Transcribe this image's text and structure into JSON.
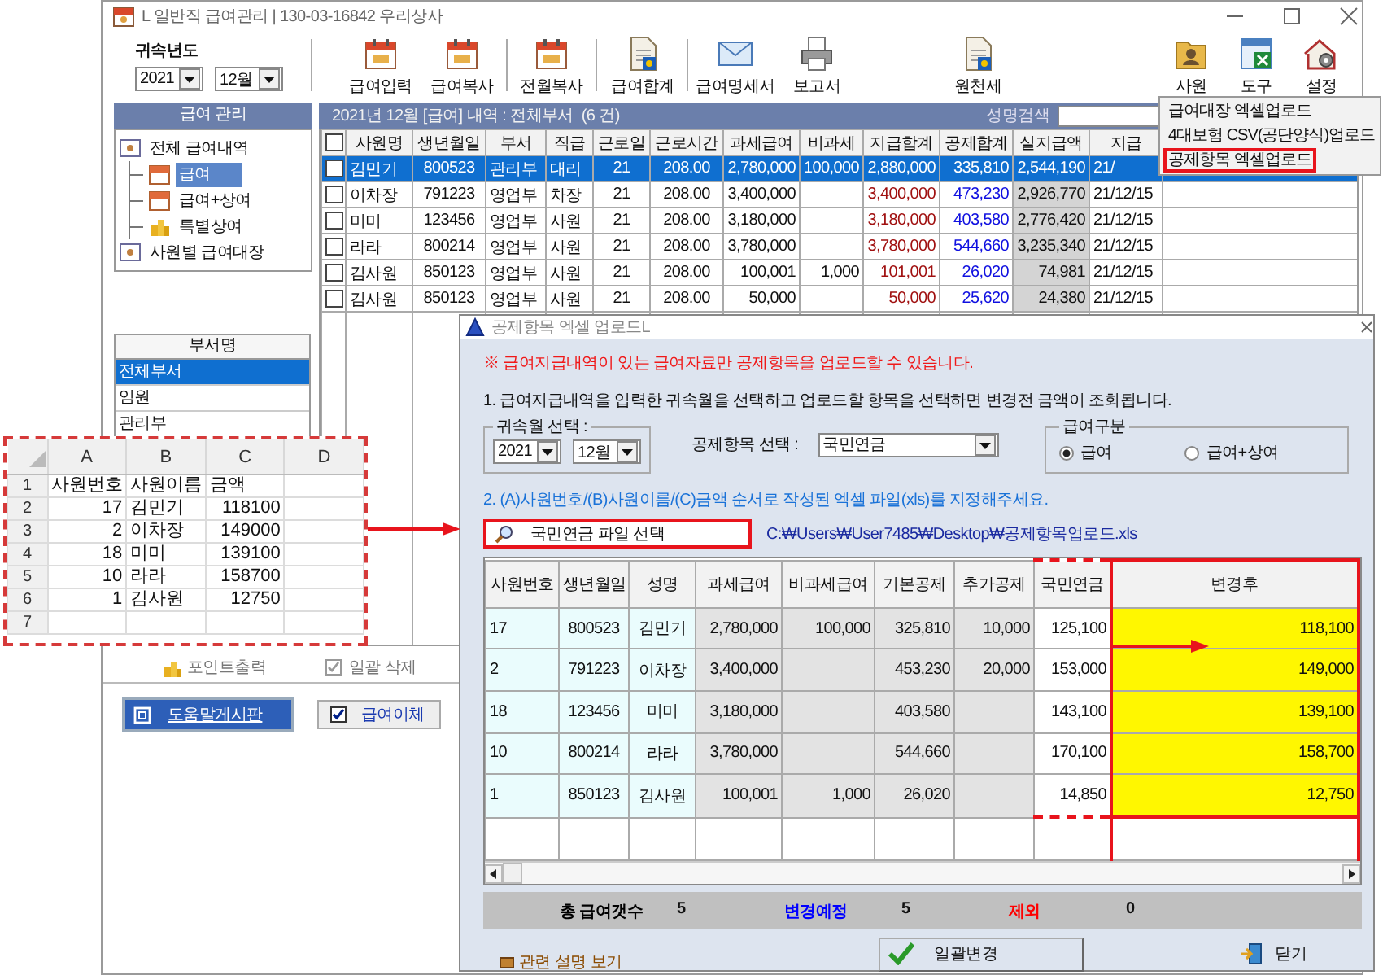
{
  "window": {
    "title": "L 일반직 급여관리 | 130-03-16842  우리상사"
  },
  "toolbar": {
    "period_label": "귀속년도",
    "year": "2021",
    "month": "12월",
    "buttons": [
      "급여입력",
      "급여복사",
      "전월복사",
      "급여합계",
      "급여명세서",
      "보고서",
      "원천세",
      "사원",
      "도구",
      "설정"
    ]
  },
  "sidebar": {
    "title": "급여 관리",
    "tree": [
      {
        "label": "전체 급여내역",
        "selected": false,
        "children": [
          {
            "label": "급여",
            "selected": true
          },
          {
            "label": "급여+상여",
            "selected": false
          },
          {
            "label": "특별상여",
            "selected": false
          }
        ]
      },
      {
        "label": "사원별 급여대장",
        "selected": false
      }
    ]
  },
  "departments": {
    "header": "부서명",
    "items": [
      {
        "label": "전체부서",
        "selected": true
      },
      {
        "label": "임원",
        "selected": false
      },
      {
        "label": "관리부",
        "selected": false
      }
    ]
  },
  "bottom_actions": [
    "포인트출력",
    "일괄 삭제"
  ],
  "bottom_buttons": [
    {
      "label": "도움말게시판",
      "kind": "link"
    },
    {
      "label": "급여이체",
      "kind": "check"
    }
  ],
  "payroll_table": {
    "caption": "2021년 12월 [급여] 내역 : 전체부서  (6 건)",
    "search_label": "성명검색",
    "select_all_checked": false,
    "columns": [
      "사원명",
      "생년월일",
      "부서",
      "직급",
      "근로일",
      "근로시간",
      "과세급여",
      "비과세",
      "지급합계",
      "공제합계",
      "실지급액",
      "지급"
    ],
    "rows": [
      {
        "checked": false,
        "selected": true,
        "cells": [
          "김민기",
          "800523",
          "관리부",
          "대리",
          "21",
          "208.00",
          "2,780,000",
          "100,000",
          "2,880,000",
          "335,810",
          "2,544,190",
          "21/"
        ]
      },
      {
        "checked": false,
        "selected": false,
        "cells": [
          "이차장",
          "791223",
          "영업부",
          "차장",
          "21",
          "208.00",
          "3,400,000",
          null,
          "3,400,000",
          "473,230",
          "2,926,770",
          "21/12/15"
        ]
      },
      {
        "checked": false,
        "selected": false,
        "cells": [
          "미미",
          "123456",
          "영업부",
          "사원",
          "21",
          "208.00",
          "3,180,000",
          null,
          "3,180,000",
          "403,580",
          "2,776,420",
          "21/12/15"
        ]
      },
      {
        "checked": false,
        "selected": false,
        "cells": [
          "라라",
          "800214",
          "영업부",
          "사원",
          "21",
          "208.00",
          "3,780,000",
          null,
          "3,780,000",
          "544,660",
          "3,235,340",
          "21/12/15"
        ]
      },
      {
        "checked": false,
        "selected": false,
        "cells": [
          "김사원",
          "850123",
          "영업부",
          "사원",
          "21",
          "208.00",
          "100,001",
          "1,000",
          "101,001",
          "26,020",
          "74,981",
          "21/12/15"
        ]
      },
      {
        "checked": false,
        "selected": false,
        "cells": [
          "김사원",
          "850123",
          "영업부",
          "사원",
          "21",
          "208.00",
          "50,000",
          null,
          "50,000",
          "25,620",
          "24,380",
          "21/12/15"
        ]
      }
    ]
  },
  "menu": {
    "items": [
      {
        "label": "급여대장 엑셀업로드",
        "outlined": false
      },
      {
        "label": "4대보험 CSV(공단양식)업로드",
        "outlined": false
      },
      {
        "label": "공제항목 엑셀업로드",
        "outlined": true
      }
    ]
  },
  "dialog": {
    "title": "공제항목 엑셀 업로드L",
    "warning": "※  급여지급내역이 있는 급여자료만 공제항목을 업로드할 수 있습니다.",
    "step1": "1. 급여지급내역을 입력한 귀속월을 선택하고 업로드할 항목을 선택하면 변경전 금액이 조회됩니다.",
    "period": {
      "legend": "귀속월 선택 :",
      "year": "2021",
      "month": "12월"
    },
    "deduction": {
      "label": "공제항목 선택 :",
      "value": "국민연금"
    },
    "pay_type": {
      "legend": "급여구분",
      "options": [
        {
          "label": "급여",
          "selected": true
        },
        {
          "label": "급여+상여",
          "selected": false
        }
      ]
    },
    "step2": "2. (A)사원번호/(B)사원이름/(C)금액 순서로 작성된 엑셀 파일(xls)를 지정해주세요.",
    "file_button": "국민연금 파일 선택",
    "file_path": "C:₩Users₩User7485₩Desktop₩공제항목업로드.xls",
    "table": {
      "columns": [
        "사원번호",
        "생년월일",
        "성명",
        "과세급여",
        "비과세급여",
        "기본공제",
        "추가공제",
        "국민연금",
        "변경후"
      ],
      "rows": [
        [
          "17",
          "800523",
          "김민기",
          "2,780,000",
          "100,000",
          "325,810",
          "10,000",
          "125,100",
          "118,100"
        ],
        [
          "2",
          "791223",
          "이차장",
          "3,400,000",
          null,
          "453,230",
          "20,000",
          "153,000",
          "149,000"
        ],
        [
          "18",
          "123456",
          "미미",
          "3,180,000",
          null,
          "403,580",
          null,
          "143,100",
          "139,100"
        ],
        [
          "10",
          "800214",
          "라라",
          "3,780,000",
          null,
          "544,660",
          null,
          "170,100",
          "158,700"
        ],
        [
          "1",
          "850123",
          "김사원",
          "100,001",
          "1,000",
          "26,020",
          null,
          "14,850",
          "12,750"
        ]
      ]
    },
    "summary": [
      {
        "label": "총 급여갯수",
        "value": "5",
        "color": "#000000"
      },
      {
        "label": "변경예정",
        "value": "5",
        "color": "#0000ff"
      },
      {
        "label": "제외",
        "value": "0",
        "color": "#ff0000"
      }
    ],
    "help_link": "관련 설명 보기",
    "apply_button": "일괄변경",
    "close_button": "닫기"
  },
  "excel": {
    "columns": [
      "A",
      "B",
      "C",
      "D"
    ],
    "rows": [
      {
        "number": "1",
        "kind": "header",
        "cells": [
          "사원번호",
          "사원이름",
          "금액"
        ]
      },
      {
        "number": "2",
        "kind": "data",
        "cells": [
          "17",
          "김민기",
          "118100"
        ]
      },
      {
        "number": "3",
        "kind": "data",
        "cells": [
          "2",
          "이차장",
          "149000"
        ]
      },
      {
        "number": "4",
        "kind": "data",
        "cells": [
          "18",
          "미미",
          "139100"
        ]
      },
      {
        "number": "5",
        "kind": "data",
        "cells": [
          "10",
          "라라",
          "158700"
        ]
      },
      {
        "number": "6",
        "kind": "data",
        "cells": [
          "1",
          "김사원",
          "12750"
        ]
      },
      {
        "number": "7",
        "kind": "data"
      }
    ]
  }
}
